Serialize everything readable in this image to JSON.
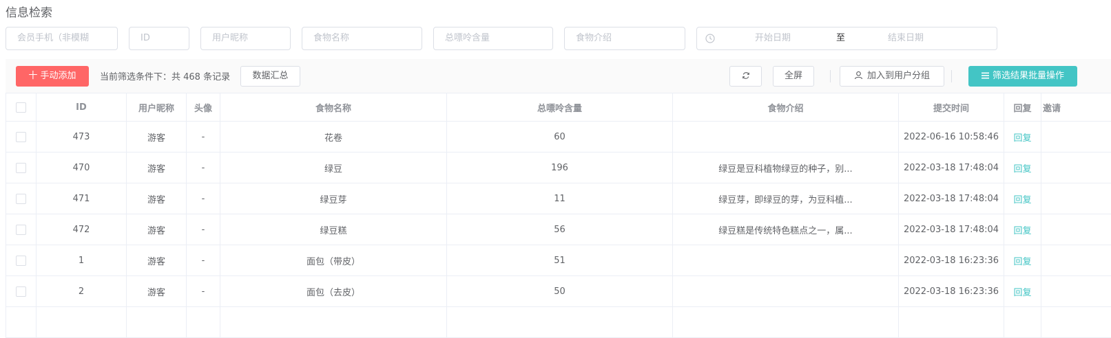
{
  "page": {
    "title": "信息检索"
  },
  "filters": {
    "phone_placeholder": "会员手机（非模糊",
    "id_placeholder": "ID",
    "nickname_placeholder": "用户昵称",
    "food_name_placeholder": "食物名称",
    "purine_placeholder": "总嘌呤含量",
    "food_intro_placeholder": "食物介绍",
    "start_date_placeholder": "开始日期",
    "date_separator": "至",
    "end_date_placeholder": "结束日期"
  },
  "toolbar": {
    "add_label": "十 手动添加",
    "count_text": "当前筛选条件下：共 468 条记录",
    "summary_label": "数据汇总",
    "fullscreen_label": "全屏",
    "add_group_label": "加入到用户分组",
    "batch_label": "筛选结果批量操作"
  },
  "table": {
    "headers": {
      "id": "ID",
      "nickname": "用户昵称",
      "avatar": "头像",
      "food_name": "食物名称",
      "purine": "总嘌呤含量",
      "intro": "食物介绍",
      "time": "提交时间",
      "reply": "回复",
      "extra": "邀请"
    },
    "rows": [
      {
        "id": "473",
        "nickname": "游客",
        "avatar": "-",
        "food_name": "花卷",
        "purine": "60",
        "intro": "",
        "time": "2022-06-16 10:58:46",
        "reply": "回复"
      },
      {
        "id": "470",
        "nickname": "游客",
        "avatar": "-",
        "food_name": "绿豆",
        "purine": "196",
        "intro": "绿豆是豆科植物绿豆的种子，别...",
        "time": "2022-03-18 17:48:04",
        "reply": "回复"
      },
      {
        "id": "471",
        "nickname": "游客",
        "avatar": "-",
        "food_name": "绿豆芽",
        "purine": "11",
        "intro": "绿豆芽，即绿豆的芽，为豆科植...",
        "time": "2022-03-18 17:48:04",
        "reply": "回复"
      },
      {
        "id": "472",
        "nickname": "游客",
        "avatar": "-",
        "food_name": "绿豆糕",
        "purine": "56",
        "intro": "绿豆糕是传统特色糕点之一，属...",
        "time": "2022-03-18 17:48:04",
        "reply": "回复"
      },
      {
        "id": "1",
        "nickname": "游客",
        "avatar": "-",
        "food_name": "面包（带皮）",
        "purine": "51",
        "intro": "",
        "time": "2022-03-18 16:23:36",
        "reply": "回复"
      },
      {
        "id": "2",
        "nickname": "游客",
        "avatar": "-",
        "food_name": "面包（去皮）",
        "purine": "50",
        "intro": "",
        "time": "2022-03-18 16:23:36",
        "reply": "回复"
      }
    ]
  },
  "icons": {
    "refresh": "refresh-icon",
    "user": "user-icon",
    "list": "list-icon",
    "clock": "clock-icon"
  },
  "colors": {
    "add_button": "#ff6666",
    "batch_button": "#43c5c5",
    "reply_link": "#43c5c5"
  }
}
